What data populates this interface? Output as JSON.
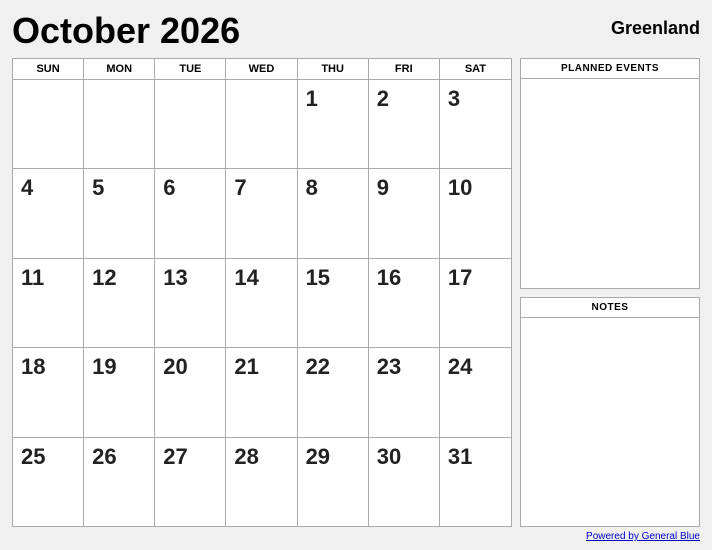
{
  "header": {
    "title": "October 2026",
    "location": "Greenland"
  },
  "calendar": {
    "days_of_week": [
      "SUN",
      "MON",
      "TUE",
      "WED",
      "THU",
      "FRI",
      "SAT"
    ],
    "rows": [
      [
        "",
        "",
        "",
        "",
        "1",
        "2",
        "3"
      ],
      [
        "4",
        "5",
        "6",
        "7",
        "8",
        "9",
        "10"
      ],
      [
        "11",
        "12",
        "13",
        "14",
        "15",
        "16",
        "17"
      ],
      [
        "18",
        "19",
        "20",
        "21",
        "22",
        "23",
        "24"
      ],
      [
        "25",
        "26",
        "27",
        "28",
        "29",
        "30",
        "31"
      ]
    ]
  },
  "sidebar": {
    "planned_events_label": "PLANNED EVENTS",
    "notes_label": "NOTES"
  },
  "footer": {
    "link_text": "Powered by General Blue"
  }
}
